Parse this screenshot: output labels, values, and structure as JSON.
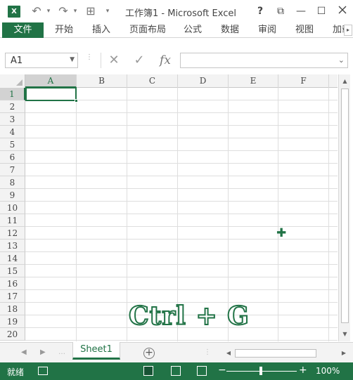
{
  "window": {
    "logo_text": "X",
    "title": "工作簿1 - Microsoft Excel",
    "help_label": "?",
    "restore_label": "⧉",
    "minimize_label": "—",
    "maximize_label": "☐",
    "undo_label": "↶",
    "redo_label": "↷",
    "border_label": "⊞",
    "qa_more_label": "▾"
  },
  "ribbon": {
    "tabs": [
      {
        "label": "文件"
      },
      {
        "label": "开始"
      },
      {
        "label": "插入"
      },
      {
        "label": "页面布局"
      },
      {
        "label": "公式"
      },
      {
        "label": "数据"
      },
      {
        "label": "审阅"
      },
      {
        "label": "视图"
      },
      {
        "label": "加载"
      }
    ],
    "scroll_label": "▸"
  },
  "formula_bar": {
    "name_box_value": "A1",
    "cancel_label": "✕",
    "enter_label": "✓",
    "fx_label": "fx",
    "formula_value": ""
  },
  "grid": {
    "columns": [
      "A",
      "B",
      "C",
      "D",
      "E",
      "F"
    ],
    "rows": [
      "1",
      "2",
      "3",
      "4",
      "5",
      "6",
      "7",
      "8",
      "9",
      "10",
      "11",
      "12",
      "13",
      "14",
      "15",
      "16",
      "17",
      "18",
      "19",
      "20"
    ],
    "selected_cell": "A1",
    "overlay_text": "Ctrl + G"
  },
  "sheets": {
    "tabs": [
      {
        "label": "Sheet1"
      }
    ],
    "add_label": "+"
  },
  "status": {
    "ready_text": "就绪",
    "zoom_minus": "−",
    "zoom_plus": "+",
    "zoom_percent": "100%",
    "zoom_level": 100
  },
  "colors": {
    "accent": "#217346"
  }
}
